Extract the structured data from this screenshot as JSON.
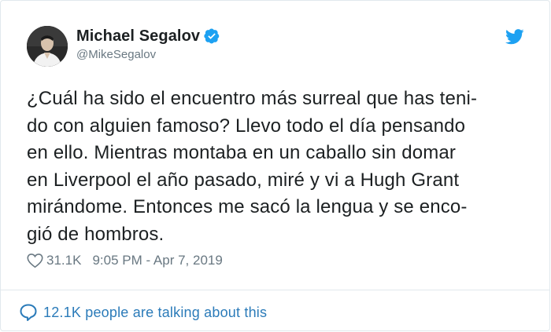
{
  "author": {
    "display_name": "Michael Segalov",
    "handle": "@MikeSegalov",
    "verified": true,
    "avatar_icon": "profile-photo"
  },
  "tweet": {
    "lines": [
      "¿Cuál ha sido el encuentro más surreal que has teni-",
      "do con alguien famoso? Llevo todo el día pensando",
      "en ello. Mientras montaba en un caballo sin domar",
      "en Liverpool el año pasado, miré y vi a Hugh Grant",
      "mirándome. Entonces me sacó la lengua y se enco-",
      "gió de hombros."
    ]
  },
  "meta": {
    "likes": "31.1K",
    "timestamp": "9:05 PM - Apr 7, 2019"
  },
  "footer": {
    "talking": "12.1K people are talking about this"
  },
  "colors": {
    "verified_blue": "#1da1f2",
    "link_blue": "#2b7bb9",
    "muted_gray": "#697882"
  },
  "icons": {
    "brand": "twitter-bird-icon",
    "verified": "verified-badge-icon",
    "like": "heart-icon",
    "conversation": "speech-bubble-icon"
  }
}
